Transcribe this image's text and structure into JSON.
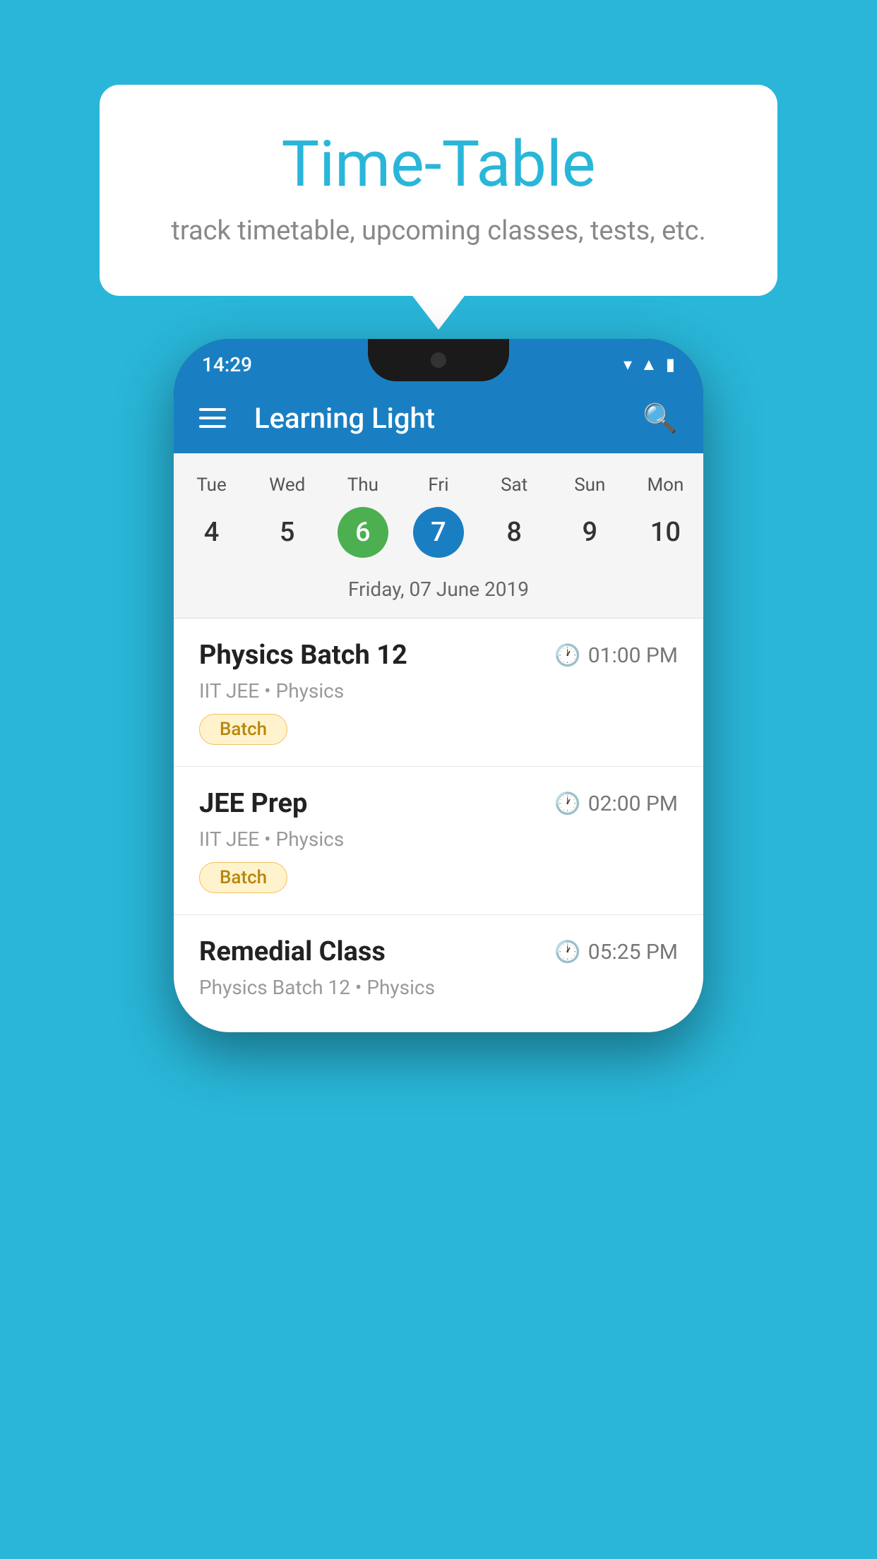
{
  "background_color": "#29B6D8",
  "speech_bubble": {
    "title": "Time-Table",
    "subtitle": "track timetable, upcoming classes, tests, etc."
  },
  "phone": {
    "status_bar": {
      "time": "14:29",
      "icons": [
        "wifi",
        "signal",
        "battery"
      ]
    },
    "app_bar": {
      "title": "Learning Light"
    },
    "calendar": {
      "days": [
        {
          "label": "Tue",
          "number": "4",
          "state": "normal"
        },
        {
          "label": "Wed",
          "number": "5",
          "state": "normal"
        },
        {
          "label": "Thu",
          "number": "6",
          "state": "today"
        },
        {
          "label": "Fri",
          "number": "7",
          "state": "selected"
        },
        {
          "label": "Sat",
          "number": "8",
          "state": "normal"
        },
        {
          "label": "Sun",
          "number": "9",
          "state": "normal"
        },
        {
          "label": "Mon",
          "number": "10",
          "state": "normal"
        }
      ],
      "selected_date_label": "Friday, 07 June 2019"
    },
    "events": [
      {
        "title": "Physics Batch 12",
        "time": "01:00 PM",
        "subtitle": "IIT JEE • Physics",
        "badge": "Batch"
      },
      {
        "title": "JEE Prep",
        "time": "02:00 PM",
        "subtitle": "IIT JEE • Physics",
        "badge": "Batch"
      },
      {
        "title": "Remedial Class",
        "time": "05:25 PM",
        "subtitle": "Physics Batch 12 • Physics",
        "badge": null
      }
    ]
  }
}
